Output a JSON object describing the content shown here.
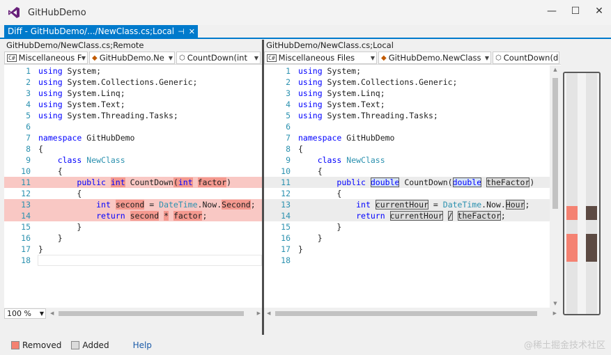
{
  "window": {
    "title": "GitHubDemo"
  },
  "tab": {
    "label": "Diff - GitHubDemo/.../NewClass.cs;Local",
    "pin": "⊣",
    "close": "✕"
  },
  "left": {
    "header": "GitHubDemo/NewClass.cs;Remote",
    "nav": [
      "Miscellaneous F",
      "GitHubDemo.Ne",
      "CountDown(int"
    ],
    "zoom": "100 %"
  },
  "right": {
    "header": "GitHubDemo/NewClass.cs;Local",
    "nav": [
      "Miscellaneous Files",
      "GitHubDemo.NewClass",
      "CountDown(double the"
    ]
  },
  "code": {
    "line_numbers": [
      "1",
      "2",
      "3",
      "4",
      "5",
      "6",
      "7",
      "8",
      "9",
      "10",
      "11",
      "12",
      "13",
      "14",
      "15",
      "16",
      "17",
      "18"
    ],
    "common": {
      "using": "using",
      "l1": " System;",
      "l2": " System.Collections.Generic;",
      "l3": " System.Linq;",
      "l4": " System.Text;",
      "l5": " System.Threading.Tasks;",
      "namespace": "namespace",
      "l7": " GitHubDemo",
      "open": "{",
      "close": "}",
      "class": "class",
      "classname": "NewClass",
      "public": "public",
      "countdown": "CountDown",
      "datetime": "DateTime",
      "now": ".Now.",
      "return": "return"
    },
    "left": {
      "int": "int",
      "factor": "factor",
      "second": "second",
      "second_prop": "Second",
      "star": "*"
    },
    "right": {
      "double": "double",
      "thefactor": "theFactor",
      "int": "int",
      "currenthour": "currentHour",
      "hour": "Hour",
      "slash": "/"
    }
  },
  "status": {
    "removed": "Removed",
    "added": "Added",
    "help": "Help",
    "watermark": "@稀土掘金技术社区"
  },
  "colors": {
    "accent": "#007acc",
    "removed": "#f9c8c4",
    "removed_highlight": "#f4998f",
    "added": "#ececec",
    "keyword": "#0000ff",
    "type": "#2b91af",
    "overview_removed": "#f48272",
    "overview_added": "#5c4a43"
  },
  "icons": {
    "app": "visual-studio-icon",
    "minimize": "minimize-icon",
    "maximize": "maximize-icon",
    "close": "close-icon"
  }
}
